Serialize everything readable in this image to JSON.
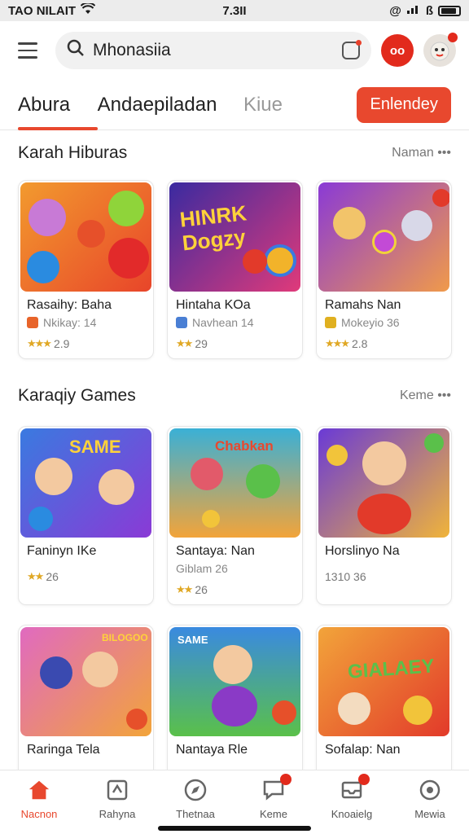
{
  "status": {
    "left": "TAO NILAIT",
    "time": "7.3II"
  },
  "search": {
    "value": "Mhonasiia"
  },
  "header": {
    "rec_label": "oo"
  },
  "tabs": [
    {
      "label": "Abura"
    },
    {
      "label": "Andaepiladan"
    },
    {
      "label": "Kiue"
    }
  ],
  "cta": {
    "label": "Enlendey"
  },
  "sections": [
    {
      "title": "Karah Hiburas",
      "more": "Naman •••"
    },
    {
      "title": "Karaqiy Games",
      "more": "Keme •••"
    }
  ],
  "row1": [
    {
      "title": "Rasaihy: Baha",
      "sub": "Nkikay: 14",
      "rating": "2.9",
      "icon_color": "#e8642a"
    },
    {
      "title": "Hintaha KOa",
      "sub": "Navhean 14",
      "rating": "29",
      "icon_color": "#4a7fd4"
    },
    {
      "title": "Ramahs Nan",
      "sub": "Mokeyio 36",
      "rating": "2.8",
      "icon_color": "#e0b020"
    }
  ],
  "row2": [
    {
      "title": "Faninyn IKe",
      "sub": "",
      "rating": "26"
    },
    {
      "title": "Santaya: Nan",
      "sub": "Giblam 26",
      "rating": "26"
    },
    {
      "title": "Horslinyo Na",
      "sub": "",
      "rating": "1310 36"
    }
  ],
  "row3": [
    {
      "title": "Raringa Tela"
    },
    {
      "title": "Nantaya Rle"
    },
    {
      "title": "Sofalap: Nan"
    }
  ],
  "thumb_texts": {
    "r1c2": "HINRK Dogzy",
    "r2c1": "SAME",
    "r2c2": "Chabkan",
    "r3c1": "BILOGOO",
    "r3c2": "SAME",
    "r3c3": "GIALAEY"
  },
  "nav": [
    {
      "label": "Nacnon",
      "icon": "home-icon",
      "active": true
    },
    {
      "label": "Rahyna",
      "icon": "document-icon"
    },
    {
      "label": "Thetnaa",
      "icon": "compass-icon"
    },
    {
      "label": "Keme",
      "icon": "chat-icon",
      "badge": true
    },
    {
      "label": "Knoaielg",
      "icon": "inbox-icon",
      "badge": true
    },
    {
      "label": "Mewia",
      "icon": "settings-icon"
    }
  ]
}
